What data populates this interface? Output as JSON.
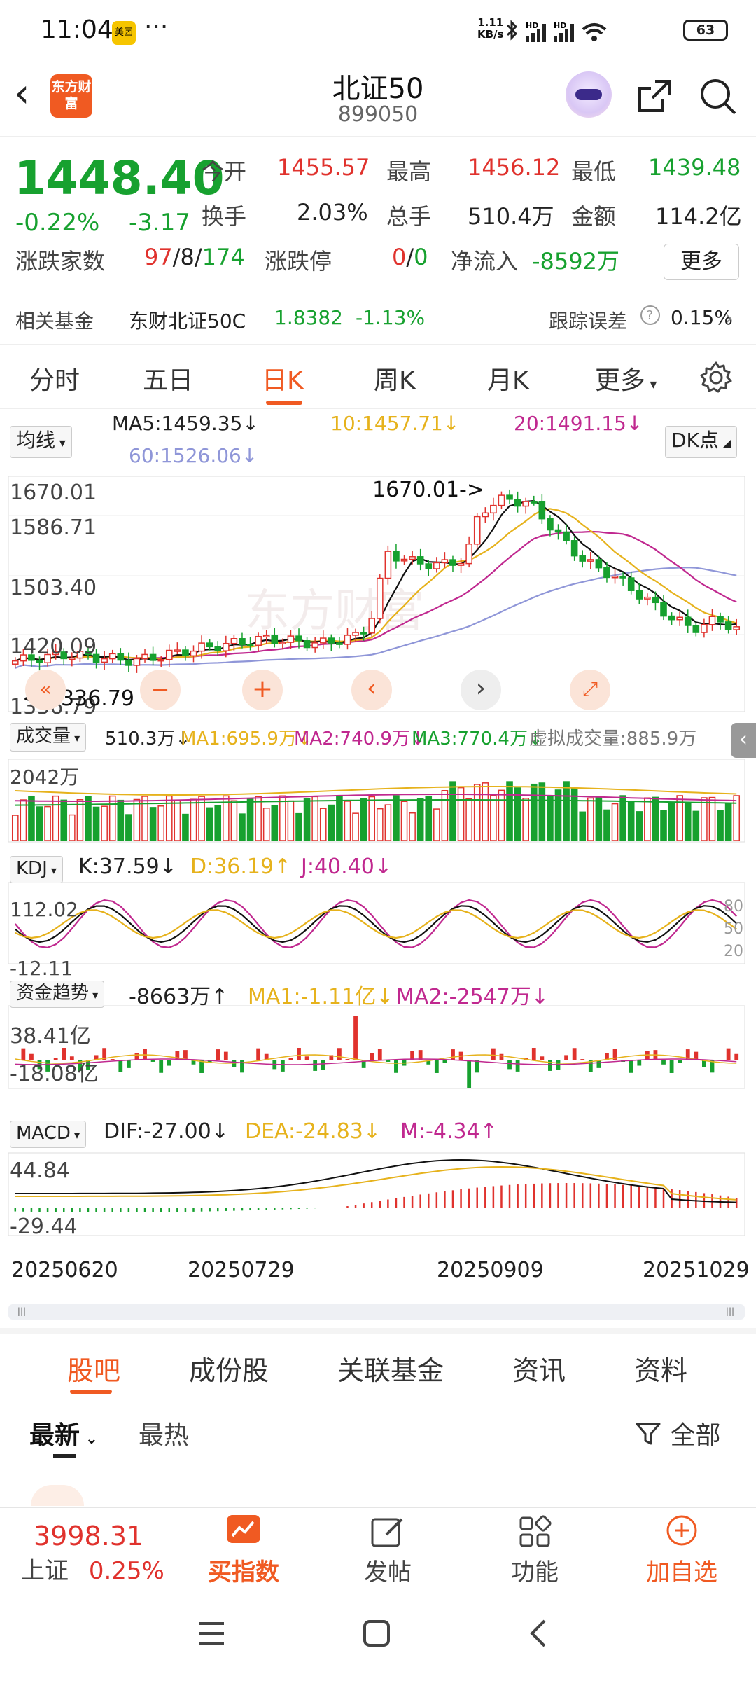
{
  "status": {
    "time": "11:04",
    "app_badge": "美团",
    "dots": "···",
    "net_speed": "1.11",
    "net_unit": "KB/s",
    "battery": "63"
  },
  "header": {
    "logo": "东方财富",
    "title": "北证50",
    "code": "899050"
  },
  "quote": {
    "price": "1448.40",
    "change_pct": "-0.22%",
    "change": "-3.17",
    "open_label": "今开",
    "open": "1455.57",
    "high_label": "最高",
    "high": "1456.12",
    "low_label": "最低",
    "low": "1439.48",
    "turnover_label": "换手",
    "turnover": "2.03%",
    "volume_label": "总手",
    "volume": "510.4万",
    "amount_label": "金额",
    "amount": "114.2亿",
    "breadth_label": "涨跌家数",
    "breadth_up": "97",
    "breadth_flat": "8",
    "breadth_down": "174",
    "breadth_sep": "/",
    "limit_label": "涨跌停",
    "limit_up": "0",
    "limit_down": "0",
    "netflow_label": "净流入",
    "netflow": "-8592万",
    "more": "更多"
  },
  "fund": {
    "label": "相关基金",
    "name": "东财北证50C",
    "price": "1.8382",
    "chg": "-1.13%",
    "err_label": "跟踪误差",
    "err": "0.15%"
  },
  "tabs": [
    "分时",
    "五日",
    "日K",
    "周K",
    "月K",
    "更多"
  ],
  "ma": {
    "selector": "均线",
    "ma5": "MA5:1459.35",
    "ma10": "10:1457.71",
    "ma20": "20:1491.15",
    "ma60": "60:1526.06",
    "dk": "DK点"
  },
  "axis": {
    "y1": "1670.01",
    "y2": "1586.71",
    "y3": "1503.40",
    "y4": "1420.09",
    "y5": "1336.79",
    "max_note": "1670.01->",
    "min_note": "<-1336.79",
    "watermark": "东方财富"
  },
  "volume": {
    "selector": "成交量",
    "v": "510.3万",
    "ma1": "MA1:695.9万",
    "ma2": "MA2:740.9万",
    "ma3": "MA3:770.4万",
    "virt": "虚拟成交量:885.9万",
    "ymax": "2042万"
  },
  "kdj": {
    "selector": "KDJ",
    "k": "K:37.59",
    "d": "D:36.19",
    "j": "J:40.40",
    "top": "112.02",
    "bottom": "-12.11",
    "l80": "80",
    "l50": "50",
    "l20": "20"
  },
  "fundflow": {
    "selector": "资金趋势",
    "v": "-8663万",
    "ma1": "MA1:-1.11亿",
    "ma2": "MA2:-2547万",
    "top": "38.41亿",
    "bottom": "-18.08亿"
  },
  "macd": {
    "selector": "MACD",
    "dif": "DIF:-27.00",
    "dea": "DEA:-24.83",
    "m": "M:-4.34",
    "top": "44.84",
    "bottom": "-29.44"
  },
  "dates": [
    "20250620",
    "20250729",
    "20250909",
    "20251029"
  ],
  "subtabs": [
    "股吧",
    "成份股",
    "关联基金",
    "资讯",
    "资料"
  ],
  "sort": {
    "latest": "最新",
    "hot": "最热",
    "filter": "全部"
  },
  "bottom": {
    "index_price": "3998.31",
    "index_name": "上证",
    "index_pct": "0.25%",
    "buy": "买指数",
    "post": "发帖",
    "func": "功能",
    "add": "加自选"
  },
  "colors": {
    "accent": "#f05a22",
    "up": "#e0322d",
    "down": "#17a12f",
    "ma10": "#e6b21c",
    "ma20": "#c0288f",
    "ma60": "#8f96d8"
  }
}
